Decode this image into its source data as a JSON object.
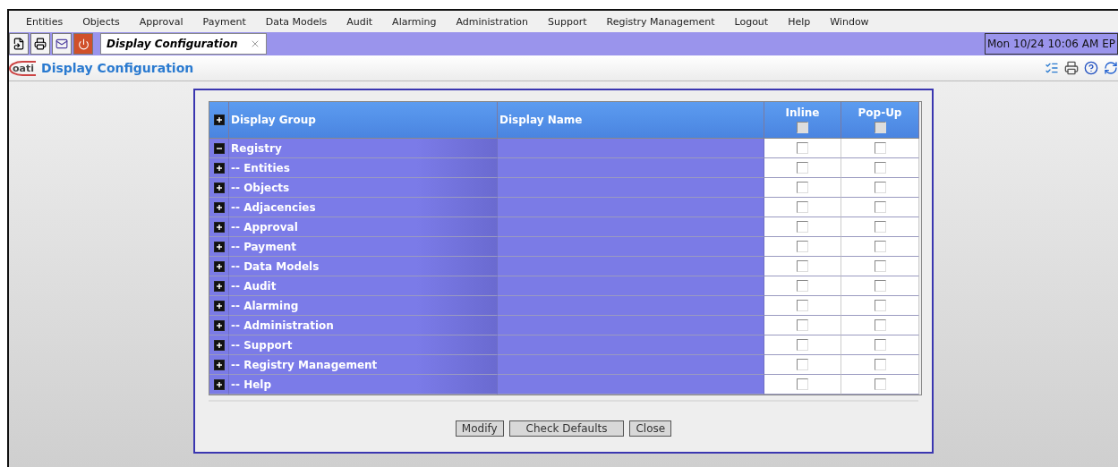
{
  "menu": [
    "Entities",
    "Objects",
    "Approval",
    "Payment",
    "Data Models",
    "Audit",
    "Alarming",
    "Administration",
    "Support",
    "Registry Management",
    "Logout",
    "Help",
    "Window"
  ],
  "tab": {
    "label": "Display Configuration",
    "selected": true
  },
  "clock": "Mon 10/24 10:06 AM EP",
  "logo": "oati",
  "page_title": "Display Configuration",
  "table": {
    "columns": [
      {
        "label": "Display Group",
        "kind": "group"
      },
      {
        "label": "Display Name",
        "kind": "name"
      },
      {
        "label": "Inline",
        "kind": "check",
        "checked": false
      },
      {
        "label": "Pop-Up",
        "kind": "check",
        "checked": false
      }
    ],
    "rows": [
      {
        "label": "Registry",
        "expanded": true,
        "inline": false,
        "popup": false,
        "children": [
          {
            "label": "-- Entities",
            "expanded": false,
            "inline": false,
            "popup": false
          },
          {
            "label": "-- Objects",
            "expanded": false,
            "inline": false,
            "popup": false
          },
          {
            "label": "-- Adjacencies",
            "expanded": false,
            "inline": false,
            "popup": false
          },
          {
            "label": "-- Approval",
            "expanded": false,
            "inline": false,
            "popup": false
          },
          {
            "label": "-- Payment",
            "expanded": false,
            "inline": false,
            "popup": false
          },
          {
            "label": "-- Data Models",
            "expanded": false,
            "inline": false,
            "popup": false
          },
          {
            "label": "-- Audit",
            "expanded": false,
            "inline": false,
            "popup": false
          },
          {
            "label": "-- Alarming",
            "expanded": false,
            "inline": false,
            "popup": false
          },
          {
            "label": "-- Administration",
            "expanded": false,
            "inline": false,
            "popup": false
          },
          {
            "label": "-- Support",
            "expanded": false,
            "inline": false,
            "popup": false
          },
          {
            "label": "-- Registry Management",
            "expanded": false,
            "inline": false,
            "popup": false
          },
          {
            "label": "-- Help",
            "expanded": false,
            "inline": false,
            "popup": false
          }
        ]
      }
    ]
  },
  "buttons": [
    "Modify",
    "Check Defaults",
    "Close"
  ]
}
